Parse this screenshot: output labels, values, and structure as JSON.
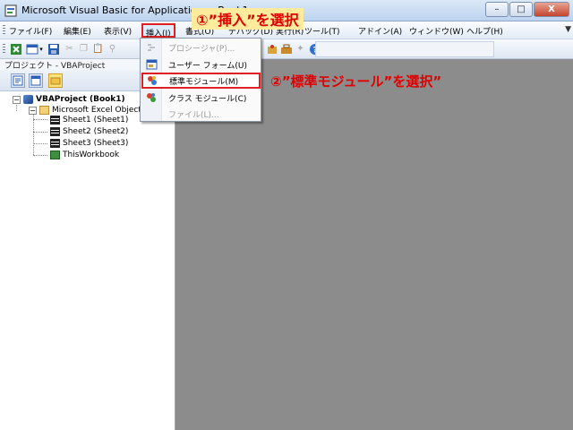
{
  "window": {
    "title": "Microsoft Visual Basic for Applications - Book1",
    "minimize": "–",
    "maximize": "□",
    "close": "X"
  },
  "menubar": {
    "items": [
      "ファイル(F)",
      "編集(E)",
      "表示(V)",
      "挿入(I)",
      "書式(O)",
      "デバッグ(D)",
      "実行(R)",
      "ツール(T)",
      "アドイン(A)",
      "ウィンドウ(W)",
      "ヘルプ(H)"
    ],
    "right_icon": "▼"
  },
  "project_pane": {
    "title": "プロジェクト - VBAProject",
    "tree": {
      "root": "VBAProject (Book1)",
      "folder": "Microsoft Excel Objects",
      "items": [
        "Sheet1 (Sheet1)",
        "Sheet2 (Sheet2)",
        "Sheet3 (Sheet3)",
        "ThisWorkbook"
      ]
    }
  },
  "insert_menu": {
    "items": [
      {
        "label": "プロシージャ(P)...",
        "icon": "procedure-icon",
        "disabled": true
      },
      {
        "label": "ユーザー フォーム(U)",
        "icon": "userform-icon",
        "disabled": false
      },
      {
        "label": "標準モジュール(M)",
        "icon": "module-icon",
        "disabled": false
      },
      {
        "label": "クラス モジュール(C)",
        "icon": "class-module-icon",
        "disabled": false
      },
      {
        "label": "ファイル(L)...",
        "icon": "",
        "disabled": true
      }
    ]
  },
  "annotations": {
    "step1": "①”挿入”を選択",
    "step2": "②”標準モジュール”を選択”"
  },
  "colors": {
    "highlight_border": "#e02020",
    "annotation_text": "#e00000",
    "annotation_bg": "#ffeb9c",
    "workspace": "#8c8c8c"
  }
}
